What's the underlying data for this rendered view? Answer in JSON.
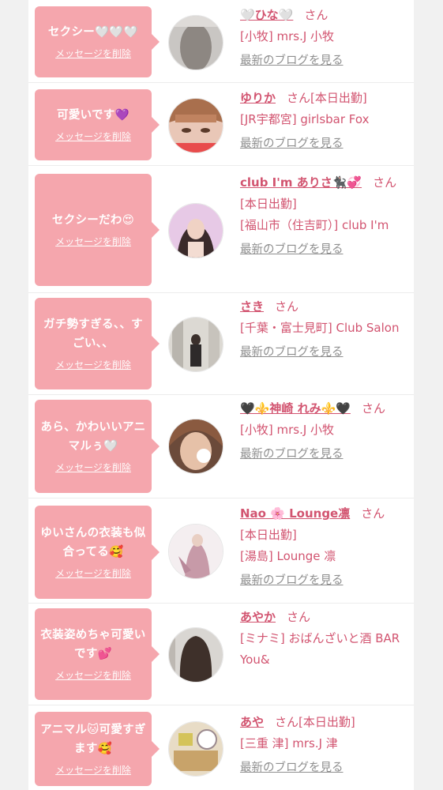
{
  "entries": [
    {
      "message": "セクシー🤍🤍🤍",
      "delete_label": "メッセージを削除",
      "name": "🤍ひな🤍",
      "suffix": "さん",
      "status": "",
      "shop": "[小牧] mrs.J 小牧",
      "blog_label": "最新のブログを見る"
    },
    {
      "message": "可愛いです💜",
      "delete_label": "メッセージを削除",
      "name": "ゆりか",
      "suffix": "さん",
      "status": "[本日出勤]",
      "shop": "[JR宇都宮] girlsbar Fox",
      "blog_label": "最新のブログを見る"
    },
    {
      "message": "セクシーだわ😍",
      "delete_label": "メッセージを削除",
      "name": "club I'm ありさ🐈‍⬛💞",
      "suffix": "さん",
      "status": "[本日出勤]",
      "shop": "[福山市（住吉町）] club I'm",
      "blog_label": "最新のブログを見る"
    },
    {
      "message": "ガチ勢すぎる、、すごい、、",
      "delete_label": "メッセージを削除",
      "name": "さき",
      "suffix": "さん",
      "status": "",
      "shop": "[千葉・富士見町] Club Salon",
      "blog_label": "最新のブログを見る"
    },
    {
      "message": "あら、かわいいアニマルぅ🤍",
      "delete_label": "メッセージを削除",
      "name": "🖤⚜️神崎 れみ⚜️🖤",
      "suffix": "さん",
      "status": "",
      "shop": "[小牧] mrs.J 小牧",
      "blog_label": "最新のブログを見る"
    },
    {
      "message": "ゆいさんの衣装も似合ってる🥰",
      "delete_label": "メッセージを削除",
      "name": "Nao 🌸 Lounge凛",
      "suffix": "さん",
      "status": "[本日出勤]",
      "shop": "[湯島] Lounge 凛",
      "blog_label": "最新のブログを見る"
    },
    {
      "message": "衣装姿めちゃ可愛いです💕",
      "delete_label": "メッセージを削除",
      "name": "あやか",
      "suffix": "さん",
      "status": "",
      "shop": "[ミナミ] おばんざいと酒 BAR You&",
      "blog_label": "最新のブログを見る"
    },
    {
      "message": "アニマル🐱可愛すぎます🥰",
      "delete_label": "メッセージを削除",
      "name": "あや",
      "suffix": "さん",
      "status": "[本日出勤]",
      "shop": "[三重 津] mrs.J 津",
      "blog_label": "最新のブログを見る"
    }
  ],
  "colors": {
    "bubble": "#f5a6ad",
    "accent": "#d25470",
    "link_gray": "#8f8f8f"
  }
}
